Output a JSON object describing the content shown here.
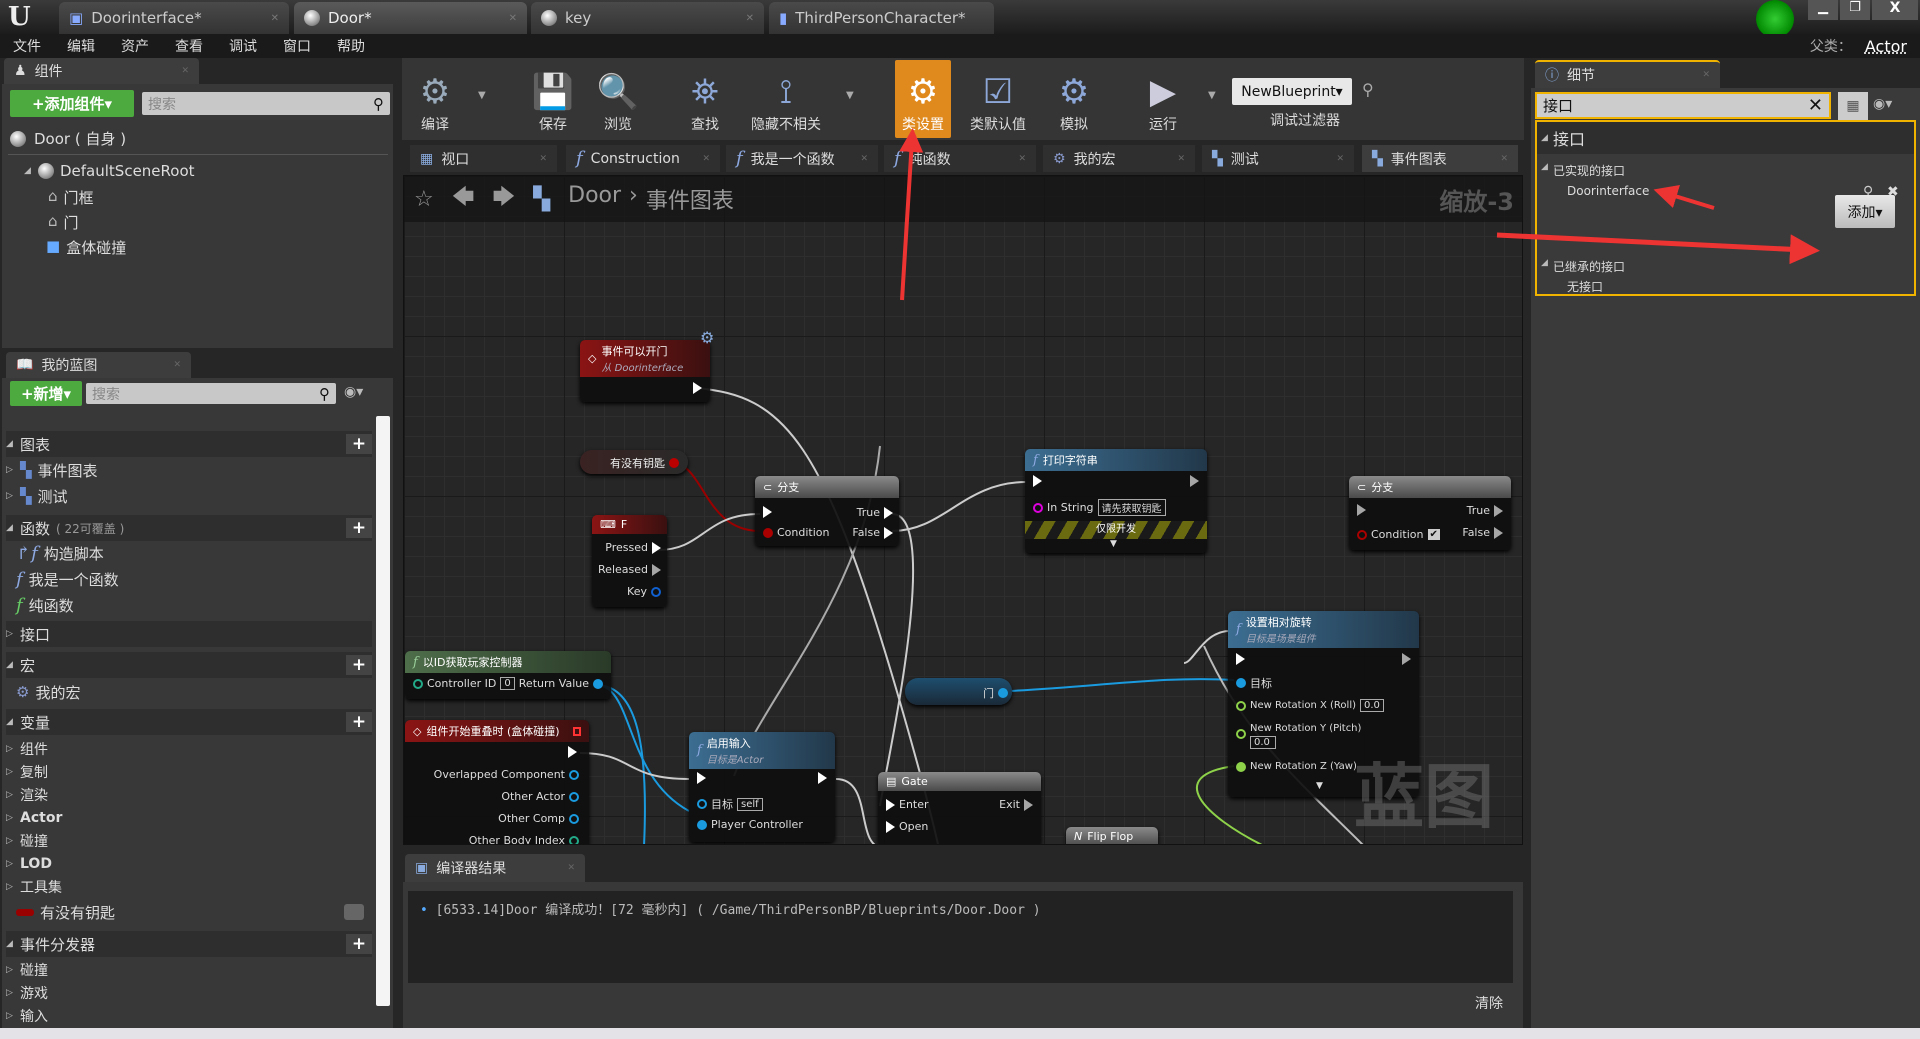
{
  "window": {
    "tabs": [
      {
        "label": "Doorinterface*"
      },
      {
        "label": "Door*"
      },
      {
        "label": "key"
      },
      {
        "label": "ThirdPersonCharacter*"
      }
    ],
    "parent_class_label": "父类：",
    "parent_class": "Actor"
  },
  "menu": [
    "文件",
    "编辑",
    "资产",
    "查看",
    "调试",
    "窗口",
    "帮助"
  ],
  "components": {
    "tab": "组件",
    "add_button": "+添加组件▾",
    "search_placeholder": "搜索",
    "self": "Door ( 自身 )",
    "tree": [
      "DefaultSceneRoot",
      "门框",
      "门",
      "盒体碰撞"
    ]
  },
  "my_blueprint": {
    "tab": "我的蓝图",
    "new_button": "+新增▾",
    "search_placeholder": "搜索",
    "graphs_header": "图表",
    "graphs": [
      "事件图表",
      "测试"
    ],
    "functions_header": "函数",
    "functions_note": "( 22可覆盖 )",
    "functions": [
      "构造脚本",
      "我是一个函数",
      "纯函数"
    ],
    "interfaces_header": "接口",
    "macros_header": "宏",
    "macros": [
      "我的宏"
    ],
    "variables_header": "变量",
    "variable_categories": [
      "组件",
      "复制",
      "渲染",
      "Actor",
      "碰撞",
      "LOD",
      "工具集"
    ],
    "variable": "有没有钥匙",
    "dispatchers_header": "事件分发器",
    "dispatcher_categories": [
      "碰撞",
      "游戏",
      "输入"
    ]
  },
  "toolbar": {
    "compile": "编译",
    "save": "保存",
    "browse": "浏览",
    "find": "查找",
    "hide_unrelated": "隐藏不相关",
    "class_settings": "类设置",
    "class_defaults": "类默认值",
    "simulate": "模拟",
    "play": "运行",
    "debug_object": "NewBlueprint▾",
    "debug_filter": "调试过滤器",
    "accent": "#e08a1e"
  },
  "graph_tabs": [
    "视口",
    "Construction Script",
    "我是一个函数",
    "纯函数",
    "我的宏",
    "测试",
    "事件图表"
  ],
  "graph": {
    "breadcrumb": [
      "Door",
      "事件图表"
    ],
    "zoom": "缩放-3",
    "watermark": "蓝图",
    "nodes": {
      "event_open": {
        "title": "事件可以开门",
        "subtitle": "从 Doorinterface"
      },
      "var_key": {
        "label": "有没有钥匙"
      },
      "branch1": {
        "title": "分支",
        "true": "True",
        "false": "False",
        "condition": "Condition"
      },
      "key_f": {
        "title": "F",
        "pressed": "Pressed",
        "released": "Released",
        "key": "Key"
      },
      "print": {
        "title": "打印字符串",
        "in_string": "In String",
        "value": "请先获取钥匙",
        "dev_only": "仅限开发"
      },
      "branch2": {
        "title": "分支",
        "true": "True",
        "false": "False",
        "condition": "Condition",
        "checked": true
      },
      "get_pc": {
        "title": "以ID获取玩家控制器",
        "controller_id": "Controller ID",
        "id_value": "0",
        "return": "Return Value"
      },
      "overlap": {
        "title": "组件开始重叠时 (盒体碰撞)",
        "pins": [
          "Overlapped Component",
          "Other Actor",
          "Other Comp",
          "Other Body Index"
        ]
      },
      "enable_input": {
        "title": "启用输入",
        "subtitle": "目标是Actor",
        "target": "目标",
        "self": "self",
        "pc": "Player Controller"
      },
      "var_door": {
        "label": "门"
      },
      "gate": {
        "title": "Gate",
        "enter": "Enter",
        "open": "Open",
        "exit": "Exit"
      },
      "flipflop": {
        "title": "Flip Flop"
      },
      "set_rot": {
        "title": "设置相对旋转",
        "subtitle": "目标是场景组件",
        "target": "目标",
        "x": "New Rotation X (Roll)",
        "x_val": "0.0",
        "y": "New Rotation Y (Pitch)",
        "y_val": "0.0",
        "z": "New Rotation Z (Yaw)"
      }
    }
  },
  "compiler": {
    "tab": "编译器结果",
    "log": "[6533.14]Door 编译成功！[72 毫秒内] ( /Game/ThirdPersonBP/Blueprints/Door.Door )",
    "clear": "清除"
  },
  "details": {
    "tab": "细节",
    "search_value": "接口",
    "section": "接口",
    "implemented_header": "已实现的接口",
    "implemented": [
      "Doorinterface"
    ],
    "add_button": "添加▾",
    "inherited_header": "已继承的接口",
    "inherited_none": "无接口",
    "highlight": "#f0b400"
  },
  "annotation_color": "#ee3333"
}
